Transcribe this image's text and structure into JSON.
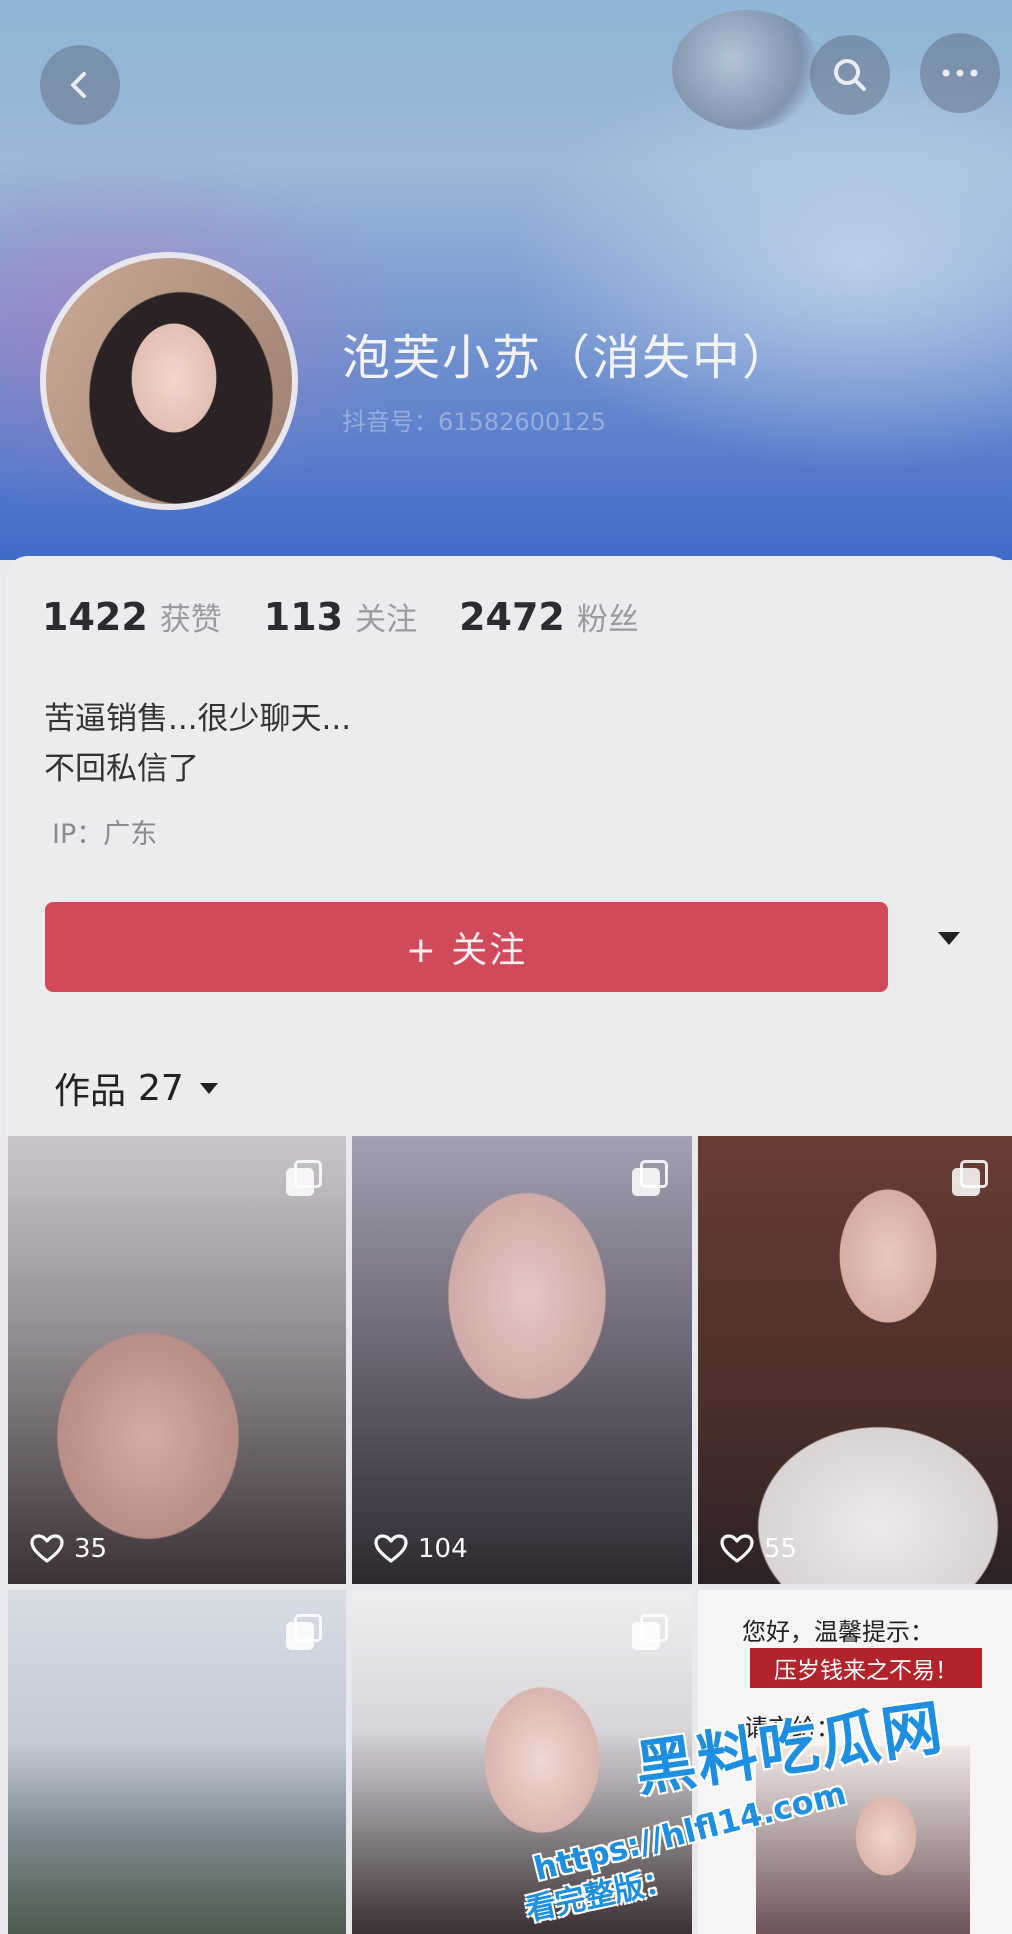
{
  "profile": {
    "name": "泡芙小苏（消失中）",
    "handle": "抖音号：61582600125",
    "stats": [
      {
        "value": "1422",
        "label": "获赞"
      },
      {
        "value": "113",
        "label": "关注"
      },
      {
        "value": "2472",
        "label": "粉丝"
      }
    ],
    "bio_lines": [
      "苦逼销售...很少聊天...",
      "不回私信了"
    ],
    "ip": "IP：广东"
  },
  "actions": {
    "follow_label": "+ 关注"
  },
  "works": {
    "tab_label": "作品",
    "count": "27",
    "items": [
      {
        "likes": "35",
        "multi": true
      },
      {
        "likes": "104",
        "multi": true
      },
      {
        "likes": "55",
        "multi": true
      },
      {
        "multi": true
      },
      {
        "multi": true
      },
      {
        "greeting": "您好，温馨提示：",
        "banner": "压岁钱来之不易！",
        "give_to": "请交给："
      }
    ]
  },
  "watermark": {
    "logo": "黑料吃瓜网",
    "label": "看完整版：",
    "url": "https://hlfl14.com"
  },
  "colors": {
    "accent": "#d04a5c",
    "header_blue": "#3f6ac8",
    "watermark": "#1e8fe0"
  },
  "icons": [
    "back-icon",
    "search-icon",
    "more-icon",
    "heart-icon",
    "multi-image-icon",
    "caret-down-icon"
  ]
}
